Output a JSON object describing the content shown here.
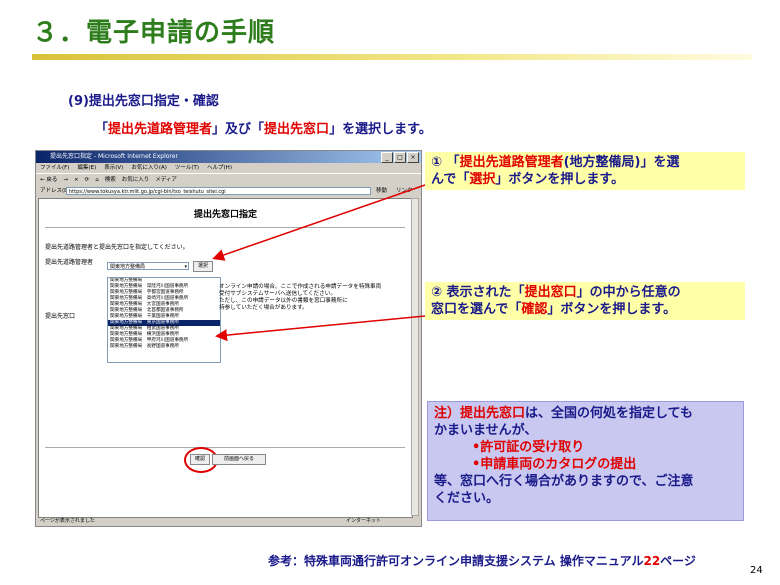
{
  "slide": {
    "title": "３．電子申請の手順",
    "section": "(9)提出先窓口指定・確認",
    "instr_parts": [
      "「",
      "提出先道路管理者",
      "」及び「",
      "提出先窓口",
      "」を選択します。"
    ]
  },
  "browser": {
    "window_title": "提出先窓口指定 - Microsoft Internet Explorer",
    "menu": [
      "ファイル(F)",
      "編集(E)",
      "表示(V)",
      "お気に入り(A)",
      "ツール(T)",
      "ヘルプ(H)"
    ],
    "toolbar": [
      "← 戻る",
      "→",
      "×",
      "⟳",
      "⌂",
      "検索",
      "お気に入り",
      "メディア"
    ],
    "address_label": "アドレス(D)",
    "address": "https://www.tokusya.ktr.mlit.go.jp/cgi-bin/tso_teishutu_sitei.cgi",
    "go_label": "移動",
    "link_label": "リンク",
    "status_left": "ページが表示されました",
    "status_right": "インターネット"
  },
  "page": {
    "heading": "提出先窓口指定",
    "prompt": "提出先道路管理者と提出先窓口を指定してください。",
    "manager_label": "提出先道路管理者",
    "manager_value": "関東地方整備局",
    "select_button": "選択",
    "window_label": "提出先窓口",
    "window_options": [
      "関東地方整備局",
      "関東地方整備局　常陸河川国道事務所",
      "関東地方整備局　宇都宮国道事務所",
      "関東地方整備局　高崎河川国道事務所",
      "関東地方整備局　大宮国道事務所",
      "関東地方整備局　北首都国道事務所",
      "関東地方整備局　千葉国道事務所",
      "関東地方整備局　東京国道事務所",
      "関東地方整備局　相武国道事務所",
      "関東地方整備局　横浜国道事務所",
      "関東地方整備局　甲府河川国道事務所",
      "関東地方整備局　長野国道事務所"
    ],
    "selected_index": 7,
    "info_lines": [
      "オンライン申請の場合、ここで作成される申請データを特殊車両",
      "受付サブシステムサーバへ送信してください。",
      "ただし、この申請データ以外の書類を窓口事務所に",
      "持参していただく場合があります。"
    ],
    "confirm_button": "確認",
    "back_button": "前画面へ戻る"
  },
  "callout1": {
    "num": "①",
    "parts": [
      "「",
      "提出先道路管理者",
      "(地方整備局)」を選",
      "んで「",
      "選択",
      "」ボタンを押します。"
    ]
  },
  "callout2": {
    "num": "②",
    "parts": [
      "表示された「",
      "提出窓口",
      "」の中から任意の",
      "窓口を選んで「",
      "確認",
      "」ボタンを押します。"
    ]
  },
  "note": {
    "lead_red": "注）提出先窓口",
    "lead_rest": "は、全国の何処を指定しても",
    "line2": "かまいませんが、",
    "items": [
      "•許可証の受け取り",
      "•申請車両のカタログの提出"
    ],
    "tail1": "等、窓口へ行く場合がありますので、ご注意",
    "tail2": "ください。"
  },
  "footer": {
    "text": "参考：特殊車両通行許可オンライン申請支援システム 操作マニュアル",
    "page_ref": "22",
    "suffix": "ページ"
  },
  "page_number": "24",
  "colors": {
    "title": "#2e7d1c",
    "accent_red": "#e00000",
    "text_navy": "#1a1a8a",
    "callout_bg": "#ffffa8",
    "note_bg": "#c8c8f0"
  }
}
